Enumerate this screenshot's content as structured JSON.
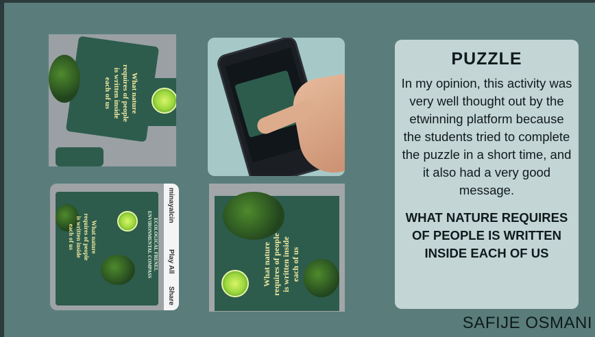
{
  "card": {
    "title": "PUZZLE",
    "body": "In my opinion, this activity was very well thought out by the etwinning platform because the students tried to complete the puzzle in a short time, and it also had a very good message.",
    "message": "WHAT NATURE REQUIRES OF PEOPLE IS WRITTEN INSIDE EACH OF US"
  },
  "author": "SAFIJE OSMANI",
  "photos": {
    "puzzle_text": "What nature\nrequires of people\nis written inside\neach of us",
    "side_user": "minayalcin",
    "side_play": "Play All",
    "side_share": "Share",
    "board_title": "ECOLOGICAL FRENEL\nENVIRONMENTAL COMPASS"
  },
  "colors": {
    "slide_bg": "#5a7d7c",
    "card_bg": "#c4d5d6",
    "puzzle_green": "#2d5c4c",
    "text_dark": "#0f1a1c"
  }
}
